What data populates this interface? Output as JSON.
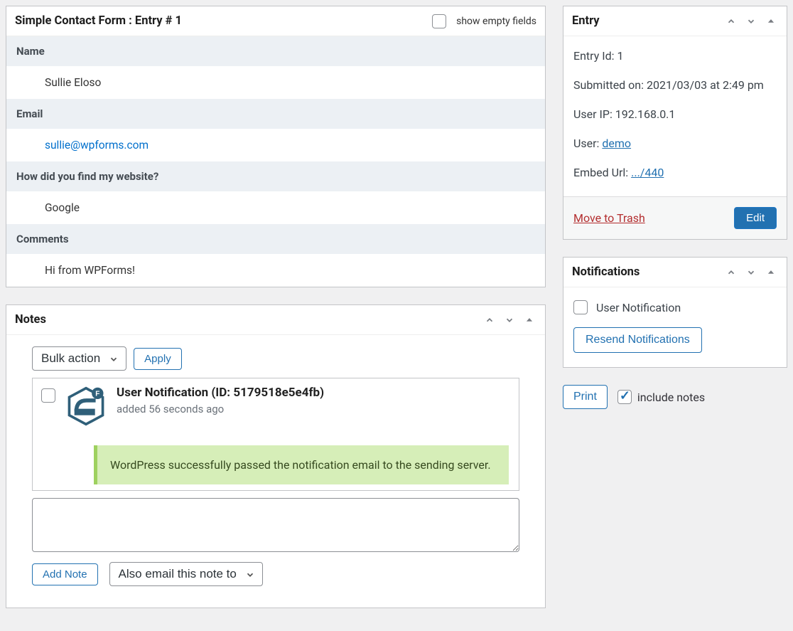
{
  "entryDetail": {
    "title": "Simple Contact Form : Entry # 1",
    "showEmptyLabel": "show empty fields",
    "fields": {
      "nameLabel": "Name",
      "nameValue": "Sullie Eloso",
      "emailLabel": "Email",
      "emailValue": "sullie@wpforms.com",
      "findLabel": "How did you find my website?",
      "findValue": "Google",
      "commentsLabel": "Comments",
      "commentsValue": "Hi from WPForms!"
    }
  },
  "notesPanel": {
    "title": "Notes",
    "bulkActionLabel": "Bulk action",
    "applyLabel": "Apply",
    "note": {
      "title": "User Notification (ID: 5179518e5e4fb)",
      "subtitle": "added 56 seconds ago",
      "success": "WordPress successfully passed the notification email to the sending server."
    },
    "addNoteLabel": "Add Note",
    "emailNoteSelect": "Also email this note to"
  },
  "entrySide": {
    "title": "Entry",
    "entryIdLabel": "Entry Id:",
    "entryIdValue": "1",
    "submittedLabel": "Submitted on:",
    "submittedValue": "2021/03/03 at 2:49 pm",
    "userIpLabel": "User IP:",
    "userIpValue": "192.168.0.1",
    "userLabel": "User:",
    "userLink": "demo",
    "embedLabel": "Embed Url:",
    "embedLink": ".../440",
    "trashLabel": "Move to Trash",
    "editLabel": "Edit"
  },
  "notifSide": {
    "title": "Notifications",
    "userNotifLabel": "User Notification",
    "resendLabel": "Resend Notifications"
  },
  "printRow": {
    "printLabel": "Print",
    "includeNotesLabel": "include notes"
  }
}
